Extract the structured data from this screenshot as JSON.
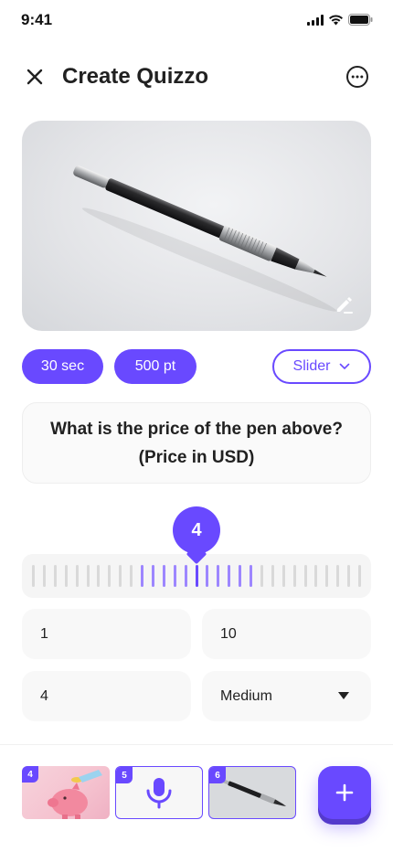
{
  "status_bar": {
    "time": "9:41"
  },
  "header": {
    "title": "Create Quizzo"
  },
  "question": {
    "time_label": "30 sec",
    "points_label": "500 pt",
    "type_label": "Slider",
    "text": "What is the price of the pen above? (Price in USD)"
  },
  "slider": {
    "value": "4",
    "min_value": "1",
    "max_value": "10",
    "answer_value": "4",
    "difficulty": "Medium"
  },
  "thumbnails": [
    {
      "number": "4",
      "icon": "piggy-bank-image"
    },
    {
      "number": "5",
      "icon": "microphone-icon"
    },
    {
      "number": "6",
      "icon": "pen-image"
    }
  ],
  "colors": {
    "accent": "#6949ff",
    "accent_shadow": "#543acc",
    "surface": "#f5f5f5"
  }
}
